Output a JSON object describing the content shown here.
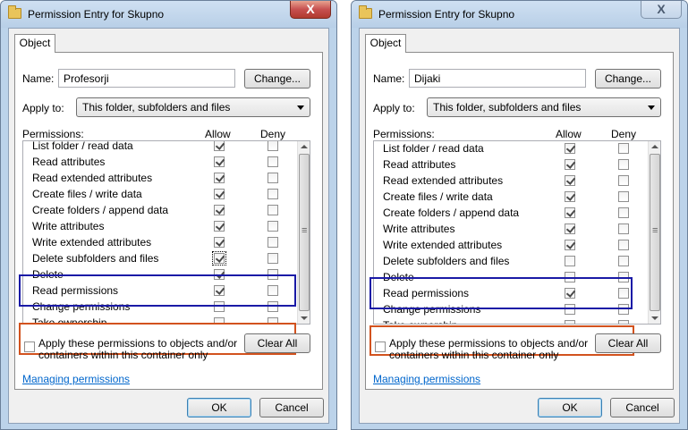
{
  "dialogs": [
    {
      "title": "Permission Entry for Skupno",
      "tab": "Object",
      "name_label": "Name:",
      "name_value": "Profesorji",
      "change_label": "Change...",
      "apply_to_label": "Apply to:",
      "apply_to_value": "This folder, subfolders and files",
      "permissions_label": "Permissions:",
      "allow_header": "Allow",
      "deny_header": "Deny",
      "permissions": [
        {
          "name": "List folder / read data",
          "allow": true,
          "deny": false
        },
        {
          "name": "Read attributes",
          "allow": true,
          "deny": false
        },
        {
          "name": "Read extended attributes",
          "allow": true,
          "deny": false
        },
        {
          "name": "Create files / write data",
          "allow": true,
          "deny": false
        },
        {
          "name": "Create folders / append data",
          "allow": true,
          "deny": false
        },
        {
          "name": "Write attributes",
          "allow": true,
          "deny": false
        },
        {
          "name": "Write extended attributes",
          "allow": true,
          "deny": false
        },
        {
          "name": "Delete subfolders and files",
          "allow": true,
          "deny": false
        },
        {
          "name": "Delete",
          "allow": true,
          "deny": false
        },
        {
          "name": "Read permissions",
          "allow": true,
          "deny": false
        },
        {
          "name": "Change permissions",
          "allow": false,
          "deny": false
        },
        {
          "name": "Take ownership",
          "allow": false,
          "deny": false
        }
      ],
      "apply_checkbox_label_1": "Apply these permissions to objects and/or",
      "apply_checkbox_label_2": "containers within this container only",
      "clear_all_label": "Clear All",
      "managing_link": "Managing permissions",
      "ok_label": "OK",
      "cancel_label": "Cancel",
      "close_label": "X"
    },
    {
      "title": "Permission Entry for Skupno",
      "tab": "Object",
      "name_label": "Name:",
      "name_value": "Dijaki",
      "change_label": "Change...",
      "apply_to_label": "Apply to:",
      "apply_to_value": "This folder, subfolders and files",
      "permissions_label": "Permissions:",
      "allow_header": "Allow",
      "deny_header": "Deny",
      "permissions": [
        {
          "name": "List folder / read data",
          "allow": true,
          "deny": false
        },
        {
          "name": "Read attributes",
          "allow": true,
          "deny": false
        },
        {
          "name": "Read extended attributes",
          "allow": true,
          "deny": false
        },
        {
          "name": "Create files / write data",
          "allow": true,
          "deny": false
        },
        {
          "name": "Create folders / append data",
          "allow": true,
          "deny": false
        },
        {
          "name": "Write attributes",
          "allow": true,
          "deny": false
        },
        {
          "name": "Write extended attributes",
          "allow": true,
          "deny": false
        },
        {
          "name": "Delete subfolders and files",
          "allow": false,
          "deny": false
        },
        {
          "name": "Delete",
          "allow": false,
          "deny": false
        },
        {
          "name": "Read permissions",
          "allow": true,
          "deny": false
        },
        {
          "name": "Change permissions",
          "allow": false,
          "deny": false
        },
        {
          "name": "Take ownership",
          "allow": false,
          "deny": false
        }
      ],
      "apply_checkbox_label_1": "Apply these permissions to objects and/or",
      "apply_checkbox_label_2": "containers within this container only",
      "clear_all_label": "Clear All",
      "managing_link": "Managing permissions",
      "ok_label": "OK",
      "cancel_label": "Cancel",
      "close_label": "X"
    }
  ],
  "colors": {
    "highlight_delete_group": "#1a1aa6",
    "highlight_ownership_group": "#d2521e",
    "link": "#0066cc"
  }
}
